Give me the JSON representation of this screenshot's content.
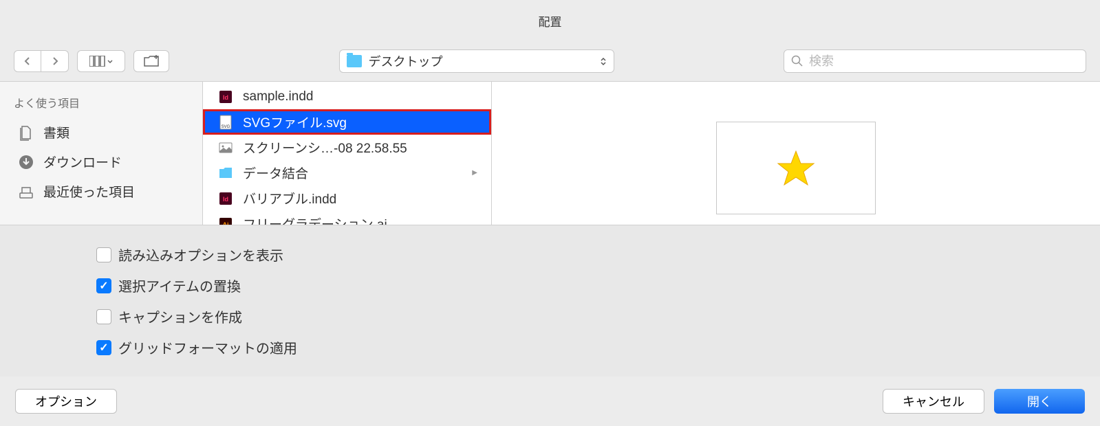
{
  "window": {
    "title": "配置"
  },
  "toolbar": {
    "location": "デスクトップ",
    "search_placeholder": "検索"
  },
  "sidebar": {
    "header": "よく使う項目",
    "items": [
      {
        "label": "書類",
        "icon": "documents-icon"
      },
      {
        "label": "ダウンロード",
        "icon": "downloads-icon"
      },
      {
        "label": "最近使った項目",
        "icon": "recents-icon"
      }
    ]
  },
  "files": [
    {
      "name": "sample.indd",
      "icon": "indd",
      "selected": false,
      "folder": false
    },
    {
      "name": "SVGファイル.svg",
      "icon": "svg",
      "selected": true,
      "folder": false,
      "highlighted": true
    },
    {
      "name": "スクリーンシ…-08 22.58.55",
      "icon": "image",
      "selected": false,
      "folder": false
    },
    {
      "name": "データ結合",
      "icon": "folder",
      "selected": false,
      "folder": true
    },
    {
      "name": "バリアブル.indd",
      "icon": "indd",
      "selected": false,
      "folder": false
    },
    {
      "name": "フリーグラデーション.ai",
      "icon": "ai",
      "selected": false,
      "folder": false
    }
  ],
  "options": [
    {
      "label": "読み込みオプションを表示",
      "checked": false
    },
    {
      "label": "選択アイテムの置換",
      "checked": true
    },
    {
      "label": "キャプションを作成",
      "checked": false
    },
    {
      "label": "グリッドフォーマットの適用",
      "checked": true
    }
  ],
  "footer": {
    "options_btn": "オプション",
    "cancel_btn": "キャンセル",
    "open_btn": "開く"
  }
}
